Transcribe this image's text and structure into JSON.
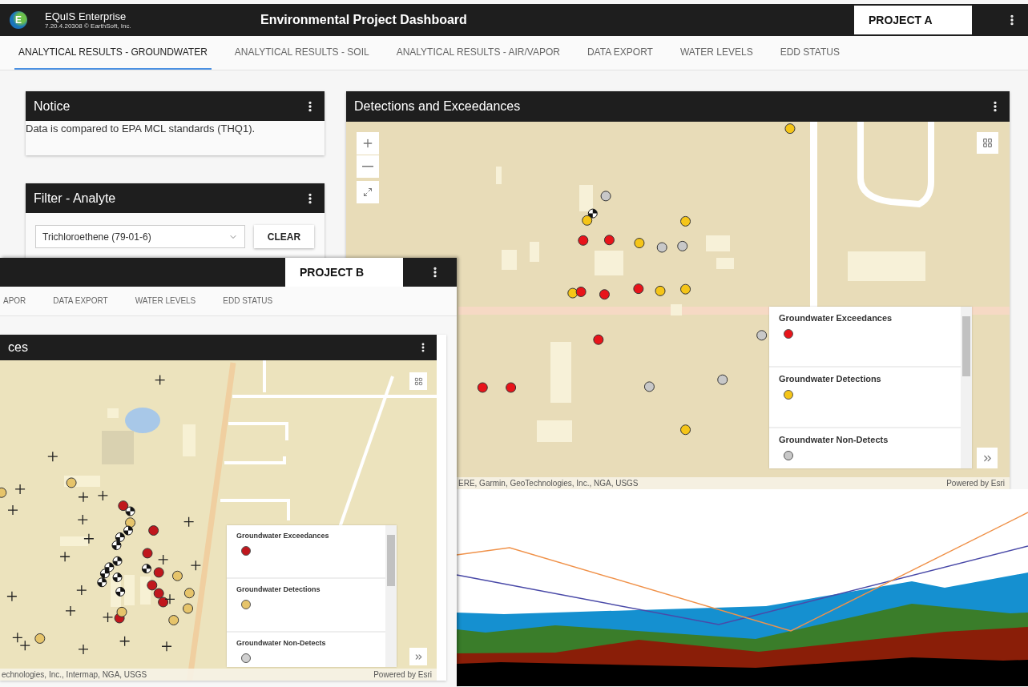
{
  "window_a": {
    "app_name": "EQuIS Enterprise",
    "version": "7.20.4.20308 © EarthSoft, Inc.",
    "logo_letter": "E",
    "title": "Environmental Project Dashboard",
    "project": "PROJECT A",
    "tabs": [
      {
        "label": "ANALYTICAL RESULTS - GROUNDWATER",
        "selected": true
      },
      {
        "label": "ANALYTICAL RESULTS - SOIL",
        "selected": false
      },
      {
        "label": "ANALYTICAL RESULTS - AIR/VAPOR",
        "selected": false
      },
      {
        "label": "DATA EXPORT",
        "selected": false
      },
      {
        "label": "WATER LEVELS",
        "selected": false
      },
      {
        "label": "EDD STATUS",
        "selected": false
      }
    ],
    "notice": {
      "title": "Notice",
      "text": "Data is compared to EPA MCL standards (THQ1)."
    },
    "filter": {
      "title": "Filter - Analyte",
      "value": "Trichloroethene (79-01-6)",
      "button": "CLEAR"
    },
    "map": {
      "title": "Detections and Exceedances",
      "legend": [
        {
          "label": "Groundwater Exceedances",
          "color": "#e8141a"
        },
        {
          "label": "Groundwater Detections",
          "color": "#f5c518"
        },
        {
          "label": "Groundwater Non-Detects",
          "color": "#c8c8c8"
        }
      ],
      "attribution": "ERE, Garmin, GeoTechnologies, Inc., NGA, USGS",
      "powered_by": "Powered by Esri"
    }
  },
  "window_b": {
    "project": "PROJECT B",
    "tabs": [
      {
        "label": "APOR",
        "selected": false
      },
      {
        "label": "DATA EXPORT",
        "selected": false
      },
      {
        "label": "WATER LEVELS",
        "selected": false
      },
      {
        "label": "EDD STATUS",
        "selected": false
      }
    ],
    "map": {
      "title": "ces",
      "legend": [
        {
          "label": "Groundwater Exceedances",
          "color": "#c0171d"
        },
        {
          "label": "Groundwater Detections",
          "color": "#e6c46a"
        },
        {
          "label": "Groundwater Non-Detects",
          "color": "#d0d0d0"
        }
      ],
      "attribution": "echnologies, Inc., Intermap, NGA, USGS",
      "powered_by": "Powered by Esri"
    }
  }
}
